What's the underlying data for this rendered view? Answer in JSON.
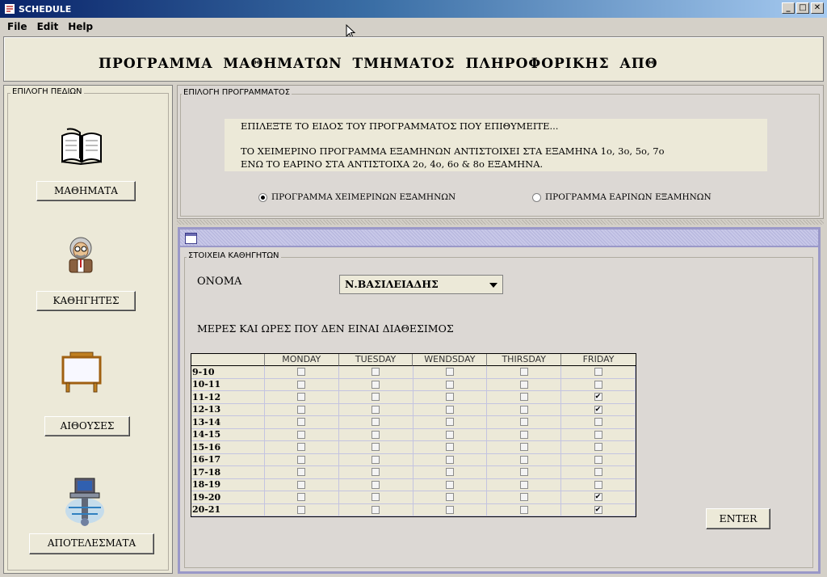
{
  "window": {
    "title": "SCHEDULE"
  },
  "menu": {
    "items": [
      "File",
      "Edit",
      "Help"
    ]
  },
  "header": {
    "title": "ΠΡΟΓΡΑΜΜΑ ΜΑΘΗΜΑΤΩΝ ΤΜΗΜΑΤΟΣ ΠΛΗΡΟΦΟΡΙΚΗΣ ΑΠΘ"
  },
  "sidebar": {
    "legend": "ΕΠΙΛΟΓΗ ΠΕΔΙΩΝ",
    "items": [
      {
        "label": "ΜΑΘΗΜΑΤΑ",
        "icon": "book-icon"
      },
      {
        "label": "ΚΑΘΗΓΗΤΕΣ",
        "icon": "professor-icon"
      },
      {
        "label": "ΑΙΘΟΥΣΕΣ",
        "icon": "whiteboard-icon"
      },
      {
        "label": "ΑΠΟΤΕΛΕΣΜΑΤΑ",
        "icon": "computer-icon"
      }
    ]
  },
  "program_selection": {
    "legend": "ΕΠΙΛΟΓΗ ΠΡΟΓΡΑΜΜΑΤΟΣ",
    "instruction1": "ΕΠΙΛΕΞΤΕ ΤΟ ΕΙΔΟΣ ΤΟΥ ΠΡΟΓΡΑΜΜΑΤΟΣ ΠΟΥ ΕΠΙΘΥΜΕΙΤΕ...",
    "instruction2": "ΤΟ ΧΕΙΜΕΡΙΝΟ ΠΡΟΓΡΑΜΜΑ ΕΞΑΜΗΝΩΝ ΑΝΤΙΣΤΟΙΧΕΙ ΣΤΑ ΕΞΑΜΗΝΑ 1ο, 3ο, 5ο, 7ο",
    "instruction3": "ΕΝΩ ΤΟ ΕΑΡΙΝΟ ΣΤΑ ΑΝΤΙΣΤΟΙΧΑ 2ο, 4ο, 6ο & 8ο ΕΞΑΜΗΝΑ.",
    "option_winter": "ΠΡΟΓΡΑΜΜΑ ΧΕΙΜΕΡΙΝΩΝ ΕΞΑΜΗΝΩΝ",
    "option_spring": "ΠΡΟΓΡΑΜΜΑ ΕΑΡΙΝΩΝ ΕΞΑΜΗΝΩΝ",
    "selected": "winter"
  },
  "professor": {
    "legend": "ΣΤΟΙΧΕΙΑ ΚΑΘΗΓΗΤΩΝ",
    "name_label": "ΟΝΟΜΑ",
    "name_value": "Ν.ΒΑΣΙΛΕΙΑΔΗΣ",
    "availability_label": "ΜΕΡΕΣ ΚΑΙ ΩΡΕΣ ΠΟΥ ΔΕΝ ΕΙΝΑΙ ΔΙΑΘΕΣΙΜΟΣ",
    "days": [
      "MONDAY",
      "TUESDAY",
      "WENDSDAY",
      "THIRSDAY",
      "FRIDAY"
    ],
    "slots": [
      {
        "time": "9-10",
        "checked": [
          false,
          false,
          false,
          false,
          false
        ]
      },
      {
        "time": "10-11",
        "checked": [
          false,
          false,
          false,
          false,
          false
        ]
      },
      {
        "time": "11-12",
        "checked": [
          false,
          false,
          false,
          false,
          true
        ]
      },
      {
        "time": "12-13",
        "checked": [
          false,
          false,
          false,
          false,
          true
        ]
      },
      {
        "time": "13-14",
        "checked": [
          false,
          false,
          false,
          false,
          false
        ]
      },
      {
        "time": "14-15",
        "checked": [
          false,
          false,
          false,
          false,
          false
        ]
      },
      {
        "time": "15-16",
        "checked": [
          false,
          false,
          false,
          false,
          false
        ]
      },
      {
        "time": "16-17",
        "checked": [
          false,
          false,
          false,
          false,
          false
        ]
      },
      {
        "time": "17-18",
        "checked": [
          false,
          false,
          false,
          false,
          false
        ]
      },
      {
        "time": "18-19",
        "checked": [
          false,
          false,
          false,
          false,
          false
        ]
      },
      {
        "time": "19-20",
        "checked": [
          false,
          false,
          false,
          false,
          true
        ]
      },
      {
        "time": "20-21",
        "checked": [
          false,
          false,
          false,
          false,
          true
        ]
      }
    ],
    "enter_label": "ENTER"
  }
}
